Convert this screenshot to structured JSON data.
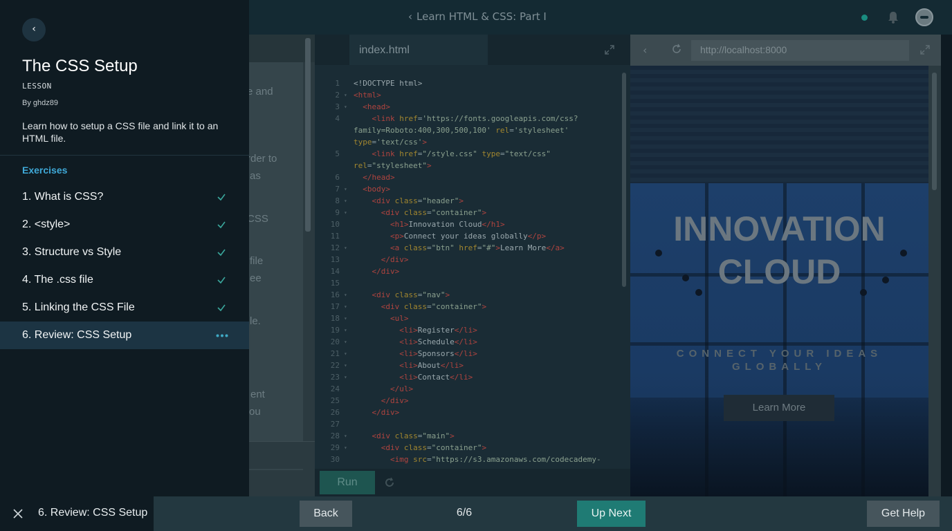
{
  "app": {
    "course_title": "Learn HTML & CSS: Part I",
    "status_color": "#1a8c80"
  },
  "sidebar": {
    "back_glyph": "‹",
    "lesson_title": "The CSS Setup",
    "lesson_type": "LESSON",
    "author": "By ghdz89",
    "description": "Learn how to setup a CSS file and link it to an HTML file.",
    "exercises_heading": "Exercises",
    "exercises": [
      {
        "label": "1. What is CSS?",
        "state": "done"
      },
      {
        "label": "2. <style>",
        "state": "done"
      },
      {
        "label": "3. Structure vs Style",
        "state": "done"
      },
      {
        "label": "4. The .css file",
        "state": "done"
      },
      {
        "label": "5. Linking the CSS File",
        "state": "done"
      },
      {
        "label": "6. Review: CSS Setup",
        "state": "current"
      }
    ]
  },
  "instructions": {
    "fragments": [
      "e and",
      "rder to",
      "as",
      "CSS",
      "file",
      "ee",
      "le.",
      "ent",
      "ou"
    ]
  },
  "editor": {
    "tab_label": "index.html",
    "run_label": "Run",
    "lines": [
      {
        "n": "1",
        "fold": false,
        "html": "<span class='txt'>&lt;!DOCTYPE html&gt;</span>"
      },
      {
        "n": "2",
        "fold": true,
        "html": "<span class='tag'>&lt;html&gt;</span>"
      },
      {
        "n": "3",
        "fold": true,
        "html": "  <span class='tag'>&lt;head&gt;</span>"
      },
      {
        "n": "4",
        "fold": false,
        "html": "    <span class='tag'>&lt;link</span> <span class='attr'>href</span>=<span class='str'>'https://fonts.googleapis.com/css?family=Roboto:400,300,500,100'</span> <span class='attr'>rel</span>=<span class='str'>'stylesheet'</span> <span class='attr'>type</span>=<span class='str'>'text/css'</span><span class='tag'>&gt;</span>"
      },
      {
        "n": "5",
        "fold": false,
        "html": "    <span class='tag'>&lt;link</span> <span class='attr'>href</span>=<span class='str'>\"/style.css\"</span> <span class='attr'>type</span>=<span class='str'>\"text/css\"</span> <span class='attr'>rel</span>=<span class='str'>\"stylesheet\"</span><span class='tag'>&gt;</span>"
      },
      {
        "n": "6",
        "fold": false,
        "html": "  <span class='tag'>&lt;/head&gt;</span>"
      },
      {
        "n": "7",
        "fold": true,
        "html": "  <span class='tag'>&lt;body&gt;</span>"
      },
      {
        "n": "8",
        "fold": true,
        "html": "    <span class='tag'>&lt;div</span> <span class='attr'>class</span>=<span class='str'>\"header\"</span><span class='tag'>&gt;</span>"
      },
      {
        "n": "9",
        "fold": true,
        "html": "      <span class='tag'>&lt;div</span> <span class='attr'>class</span>=<span class='str'>\"container\"</span><span class='tag'>&gt;</span>"
      },
      {
        "n": "10",
        "fold": false,
        "html": "        <span class='tag'>&lt;h1&gt;</span><span class='txt'>Innovation Cloud</span><span class='tag'>&lt;/h1&gt;</span>"
      },
      {
        "n": "11",
        "fold": false,
        "html": "        <span class='tag'>&lt;p&gt;</span><span class='txt'>Connect your ideas globally</span><span class='tag'>&lt;/p&gt;</span>"
      },
      {
        "n": "12",
        "fold": true,
        "html": "        <span class='tag'>&lt;a</span> <span class='attr'>class</span>=<span class='str'>\"btn\"</span> <span class='attr'>href</span>=<span class='str'>\"#\"</span><span class='tag'>&gt;</span><span class='txt'>Learn More</span><span class='tag'>&lt;/a&gt;</span>"
      },
      {
        "n": "13",
        "fold": false,
        "html": "      <span class='tag'>&lt;/div&gt;</span>"
      },
      {
        "n": "14",
        "fold": false,
        "html": "    <span class='tag'>&lt;/div&gt;</span>"
      },
      {
        "n": "15",
        "fold": false,
        "html": ""
      },
      {
        "n": "16",
        "fold": true,
        "html": "    <span class='tag'>&lt;div</span> <span class='attr'>class</span>=<span class='str'>\"nav\"</span><span class='tag'>&gt;</span>"
      },
      {
        "n": "17",
        "fold": true,
        "html": "      <span class='tag'>&lt;div</span> <span class='attr'>class</span>=<span class='str'>\"container\"</span><span class='tag'>&gt;</span>"
      },
      {
        "n": "18",
        "fold": true,
        "html": "        <span class='tag'>&lt;ul&gt;</span>"
      },
      {
        "n": "19",
        "fold": true,
        "html": "          <span class='tag'>&lt;li&gt;</span><span class='txt'>Register</span><span class='tag'>&lt;/li&gt;</span>"
      },
      {
        "n": "20",
        "fold": true,
        "html": "          <span class='tag'>&lt;li&gt;</span><span class='txt'>Schedule</span><span class='tag'>&lt;/li&gt;</span>"
      },
      {
        "n": "21",
        "fold": true,
        "html": "          <span class='tag'>&lt;li&gt;</span><span class='txt'>Sponsors</span><span class='tag'>&lt;/li&gt;</span>"
      },
      {
        "n": "22",
        "fold": true,
        "html": "          <span class='tag'>&lt;li&gt;</span><span class='txt'>About</span><span class='tag'>&lt;/li&gt;</span>"
      },
      {
        "n": "23",
        "fold": true,
        "html": "          <span class='tag'>&lt;li&gt;</span><span class='txt'>Contact</span><span class='tag'>&lt;/li&gt;</span>"
      },
      {
        "n": "24",
        "fold": false,
        "html": "        <span class='tag'>&lt;/ul&gt;</span>"
      },
      {
        "n": "25",
        "fold": false,
        "html": "      <span class='tag'>&lt;/div&gt;</span>"
      },
      {
        "n": "26",
        "fold": false,
        "html": "    <span class='tag'>&lt;/div&gt;</span>"
      },
      {
        "n": "27",
        "fold": false,
        "html": ""
      },
      {
        "n": "28",
        "fold": true,
        "html": "    <span class='tag'>&lt;div</span> <span class='attr'>class</span>=<span class='str'>\"main\"</span><span class='tag'>&gt;</span>"
      },
      {
        "n": "29",
        "fold": true,
        "html": "      <span class='tag'>&lt;div</span> <span class='attr'>class</span>=<span class='str'>\"container\"</span><span class='tag'>&gt;</span>"
      },
      {
        "n": "30",
        "fold": false,
        "html": "        <span class='tag'>&lt;img</span> <span class='attr'>src</span>=<span class='str'>\"https://s3.amazonaws.com/codecademy-</span>"
      }
    ]
  },
  "browser": {
    "url": "http://localhost:8000",
    "back_glyph": "‹",
    "hero_title": "INNOVATION CLOUD",
    "hero_subtitle": "CONNECT YOUR IDEAS GLOBALLY",
    "hero_button": "Learn More"
  },
  "bottombar": {
    "current_exercise": "6. Review: CSS Setup",
    "back_label": "Back",
    "progress": "6/6",
    "up_next_label": "Up Next",
    "get_help_label": "Get Help",
    "accent_color": "#1f7b74"
  }
}
